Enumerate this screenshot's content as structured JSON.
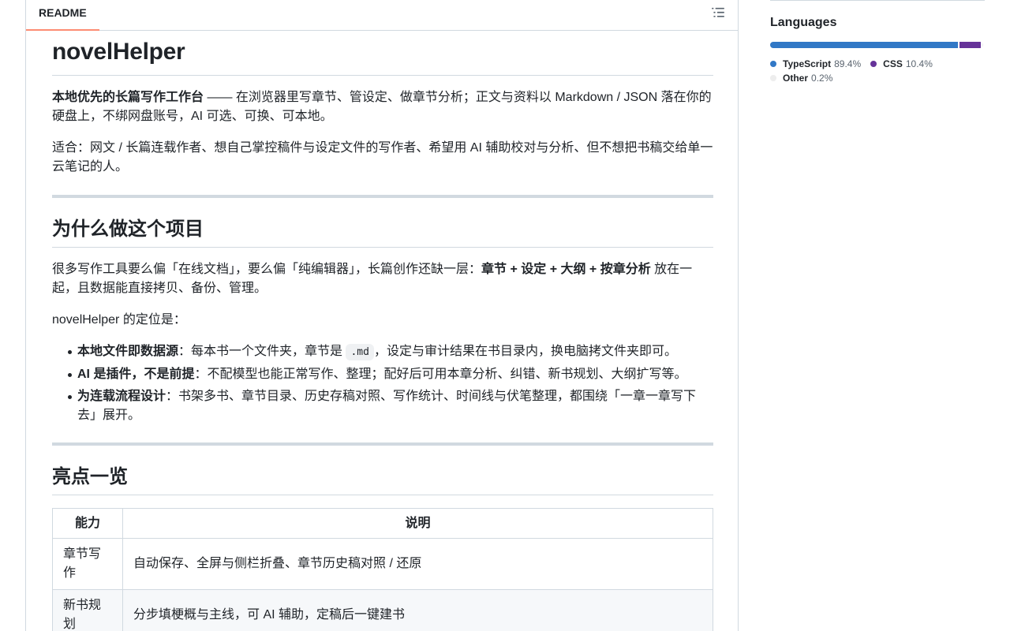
{
  "readme": {
    "tab_label": "README",
    "title": "novelHelper",
    "intro_strong": "本地优先的长篇写作工作台",
    "intro_rest": " —— 在浏览器里写章节、管设定、做章节分析；正文与资料以 Markdown / JSON 落在你的硬盘上，不绑网盘账号，AI 可选、可换、可本地。",
    "audience": "适合：网文 / 长篇连载作者、想自己掌控稿件与设定文件的写作者、希望用 AI 辅助校对与分析、但不想把书稿交给单一云笔记的人。",
    "section_why": {
      "heading": "为什么做这个项目",
      "p1_before": "很多写作工具要么偏「在线文档」，要么偏「纯编辑器」，长篇创作还缺一层：",
      "p1_strong": "章节 + 设定 + 大纲 + 按章分析",
      "p1_after": " 放在一起，且数据能直接拷贝、备份、管理。",
      "p2": "novelHelper 的定位是：",
      "bullets": [
        {
          "strong": "本地文件即数据源",
          "before": "：每本书一个文件夹，章节是 ",
          "code": ".md",
          "after": "，设定与审计结果在书目录内，换电脑拷文件夹即可。"
        },
        {
          "strong": "AI 是插件，不是前提",
          "text": "：不配模型也能正常写作、整理；配好后可用本章分析、纠错、新书规划、大纲扩写等。"
        },
        {
          "strong": "为连载流程设计",
          "text": "：书架多书、章节目录、历史存稿对照、写作统计、时间线与伏笔整理，都围绕「一章一章写下去」展开。"
        }
      ]
    },
    "section_highlights": {
      "heading": "亮点一览",
      "table": {
        "headers": [
          "能力",
          "说明"
        ],
        "rows": [
          [
            "章节写作",
            "自动保存、全屏与侧栏折叠、章节历史稿对照 / 还原"
          ],
          [
            "新书规划",
            "分步填梗概与主线，可 AI 辅助，定稿后一键建书"
          ]
        ]
      }
    }
  },
  "languages": {
    "title": "Languages",
    "items": [
      {
        "name": "TypeScript",
        "percent": "89.4%",
        "share": 89.4,
        "color": "#3178c6"
      },
      {
        "name": "CSS",
        "percent": "10.4%",
        "share": 10.4,
        "color": "#663399"
      },
      {
        "name": "Other",
        "percent": "0.2%",
        "share": 0.2,
        "color": "#ededed"
      }
    ]
  }
}
